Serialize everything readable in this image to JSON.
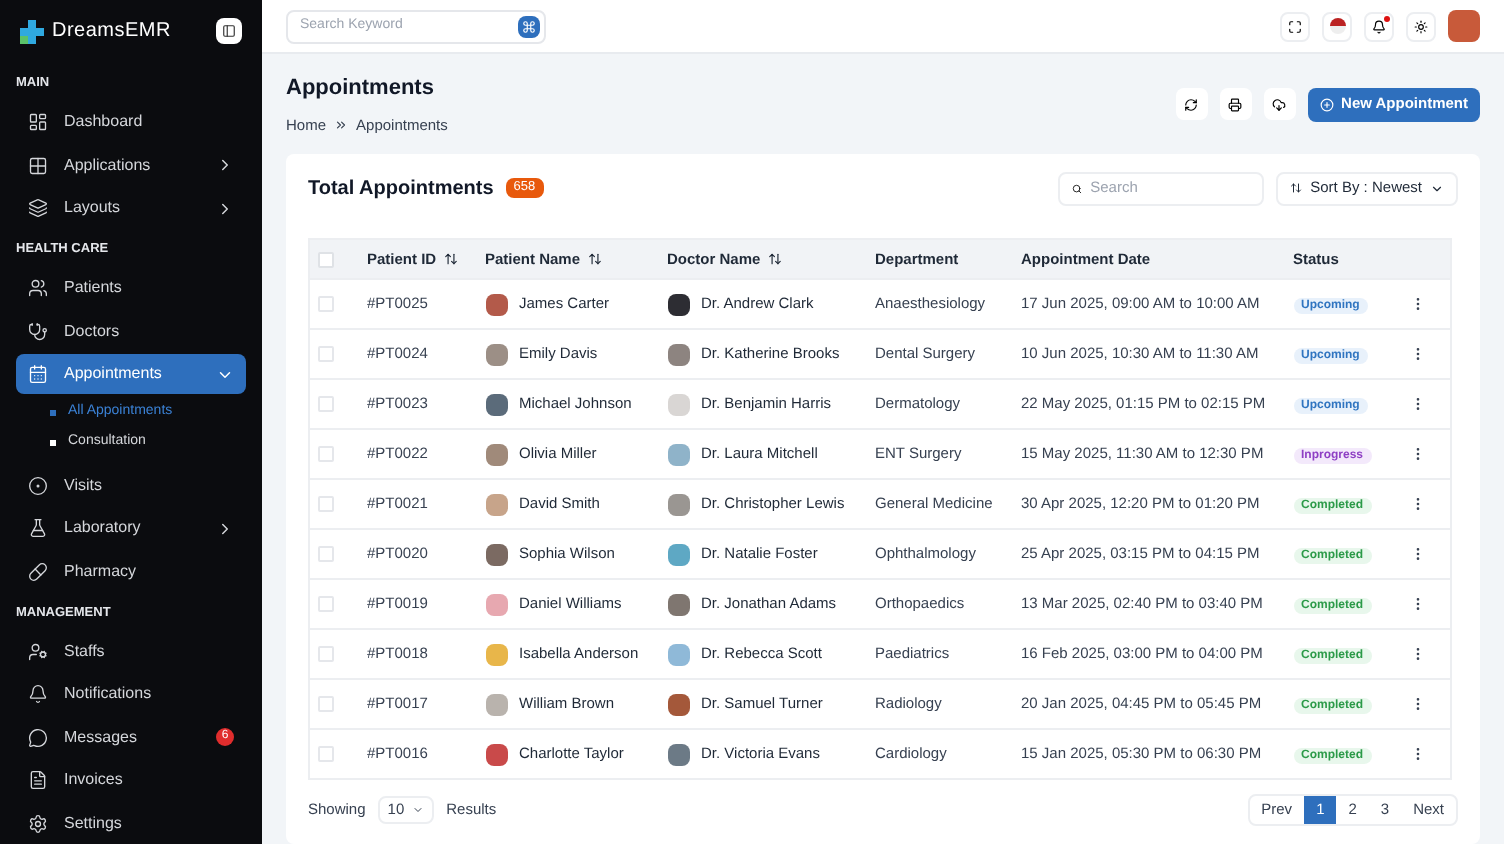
{
  "sidebar": {
    "brand": "DreamsEMR",
    "sections": [
      {
        "title": "MAIN",
        "items": [
          {
            "label": "Dashboard",
            "selected": false
          },
          {
            "label": "Applications",
            "selected": false,
            "expanded": false
          },
          {
            "label": "Layouts",
            "selected": false,
            "expanded": false
          }
        ]
      },
      {
        "title": "HEALTH CARE",
        "items": [
          {
            "label": "Patients",
            "selected": false
          },
          {
            "label": "Doctors",
            "selected": false
          },
          {
            "label": "Appointments",
            "selected": true,
            "expanded": true,
            "children": [
              {
                "label": "All Appointments",
                "selected": true
              },
              {
                "label": "Consultation",
                "selected": false
              }
            ]
          },
          {
            "label": "Visits",
            "selected": false
          },
          {
            "label": "Laboratory",
            "selected": false,
            "expanded": false
          },
          {
            "label": "Pharmacy",
            "selected": false
          }
        ]
      },
      {
        "title": "MANAGEMENT",
        "items": [
          {
            "label": "Staffs",
            "selected": false
          },
          {
            "label": "Notifications",
            "selected": false
          },
          {
            "label": "Messages",
            "selected": false,
            "badge": "6"
          },
          {
            "label": "Invoices",
            "selected": false
          },
          {
            "label": "Settings",
            "selected": false
          }
        ]
      }
    ]
  },
  "topbar": {
    "search": {
      "placeholder": "Search Keyword"
    }
  },
  "page": {
    "title": "Appointments",
    "breadcrumb": [
      "Home",
      "Appointments"
    ],
    "primary_button": "New Appointment"
  },
  "card": {
    "title": "Total Appointments",
    "count": "658",
    "search": {
      "placeholder": "Search"
    },
    "sort": {
      "label": "Sort By",
      "separator": ":",
      "value": "Newest"
    }
  },
  "table": {
    "select_all_checked": false,
    "columns": [
      {
        "label": "Patient ID",
        "sortable": true
      },
      {
        "label": "Patient Name",
        "sortable": true
      },
      {
        "label": "Doctor Name",
        "sortable": true
      },
      {
        "label": "Department",
        "sortable": false
      },
      {
        "label": "Appointment Date",
        "sortable": false
      },
      {
        "label": "Status",
        "sortable": false
      }
    ],
    "rows": [
      {
        "id": "#PT0025",
        "patient": "James Carter",
        "doctor": "Dr. Andrew Clark",
        "department": "Anaesthesiology",
        "date": "17 Jun 2025, 09:00 AM to 10:00 AM",
        "status": "Upcoming",
        "kind": "upcoming",
        "checked": false
      },
      {
        "id": "#PT0024",
        "patient": "Emily Davis",
        "doctor": "Dr. Katherine Brooks",
        "department": "Dental Surgery",
        "date": "10 Jun 2025, 10:30 AM to 11:30 AM",
        "status": "Upcoming",
        "kind": "upcoming",
        "checked": false
      },
      {
        "id": "#PT0023",
        "patient": "Michael Johnson",
        "doctor": "Dr. Benjamin Harris",
        "department": "Dermatology",
        "date": "22 May 2025, 01:15 PM to 02:15 PM",
        "status": "Upcoming",
        "kind": "upcoming",
        "checked": false
      },
      {
        "id": "#PT0022",
        "patient": "Olivia Miller",
        "doctor": "Dr. Laura Mitchell",
        "department": "ENT Surgery",
        "date": "15 May 2025, 11:30 AM to 12:30 PM",
        "status": "Inprogress",
        "kind": "inprogress",
        "checked": false
      },
      {
        "id": "#PT0021",
        "patient": "David Smith",
        "doctor": "Dr. Christopher Lewis",
        "department": "General Medicine",
        "date": "30 Apr 2025, 12:20 PM to 01:20 PM",
        "status": "Completed",
        "kind": "completed",
        "checked": false
      },
      {
        "id": "#PT0020",
        "patient": "Sophia Wilson",
        "doctor": "Dr. Natalie Foster",
        "department": "Ophthalmology",
        "date": "25 Apr 2025, 03:15 PM to 04:15 PM",
        "status": "Completed",
        "kind": "completed",
        "checked": false
      },
      {
        "id": "#PT0019",
        "patient": "Daniel Williams",
        "doctor": "Dr. Jonathan Adams",
        "department": "Orthopaedics",
        "date": "13 Mar 2025, 02:40 PM to 03:40 PM",
        "status": "Completed",
        "kind": "completed",
        "checked": false
      },
      {
        "id": "#PT0018",
        "patient": "Isabella Anderson",
        "doctor": "Dr. Rebecca Scott",
        "department": "Paediatrics",
        "date": "16 Feb 2025, 03:00 PM to 04:00 PM",
        "status": "Completed",
        "kind": "completed",
        "checked": false
      },
      {
        "id": "#PT0017",
        "patient": "William Brown",
        "doctor": "Dr. Samuel Turner",
        "department": "Radiology",
        "date": "20 Jan 2025, 04:45 PM to 05:45 PM",
        "status": "Completed",
        "kind": "completed",
        "checked": false
      },
      {
        "id": "#PT0016",
        "patient": "Charlotte Taylor",
        "doctor": "Dr. Victoria Evans",
        "department": "Cardiology",
        "date": "15 Jan 2025, 05:30 PM to 06:30 PM",
        "status": "Completed",
        "kind": "completed",
        "checked": false
      }
    ]
  },
  "footer": {
    "showing": "Showing",
    "page_size": "10",
    "results": "Results",
    "pagination": [
      {
        "label": "Prev",
        "selected": false
      },
      {
        "label": "1",
        "selected": true
      },
      {
        "label": "2",
        "selected": false
      },
      {
        "label": "3",
        "selected": false
      },
      {
        "label": "Next",
        "selected": false
      }
    ]
  }
}
